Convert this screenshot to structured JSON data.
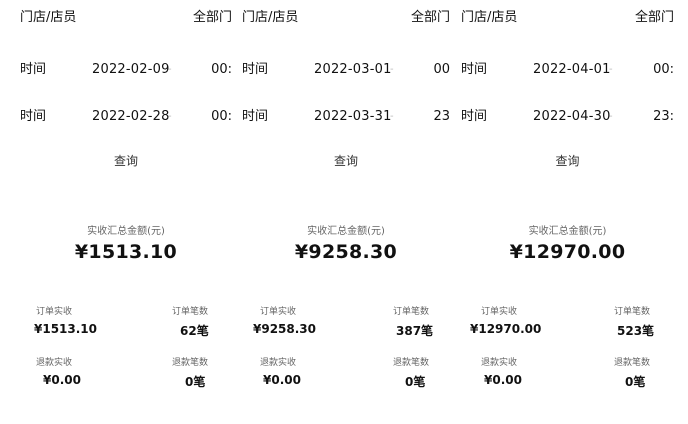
{
  "panels": [
    {
      "store_label": "门店/店员",
      "store_value": "全部门",
      "start_label": "时间",
      "start_date": "2022-02-09",
      "start_time": "00:",
      "end_label": "时间",
      "end_date": "2022-02-28",
      "end_time": "00:",
      "dash": "-",
      "query_label": "查询",
      "total_label": "实收汇总金额(元)",
      "total_value": "¥1513.10",
      "stat1_label": "订单实收",
      "stat1_value": "¥1513.10",
      "stat2_label": "订单笔数",
      "stat2_value": "62笔",
      "stat3_label": "退款实收",
      "stat3_value": "¥0.00",
      "stat4_label": "退款笔数",
      "stat4_value": "0笔"
    },
    {
      "store_label": "门店/店员",
      "store_value": "全部门",
      "start_label": "时间",
      "start_date": "2022-03-01",
      "start_time": "00",
      "end_label": "时间",
      "end_date": "2022-03-31",
      "end_time": "23",
      "dash": "-",
      "query_label": "查询",
      "total_label": "实收汇总金额(元)",
      "total_value": "¥9258.30",
      "stat1_label": "订单实收",
      "stat1_value": "¥9258.30",
      "stat2_label": "订单笔数",
      "stat2_value": "387笔",
      "stat3_label": "退款实收",
      "stat3_value": "¥0.00",
      "stat4_label": "退款笔数",
      "stat4_value": "0笔"
    },
    {
      "store_label": "门店/店员",
      "store_value": "全部门",
      "start_label": "时间",
      "start_date": "2022-04-01",
      "start_time": "00:",
      "end_label": "时间",
      "end_date": "2022-04-30",
      "end_time": "23:",
      "dash": "-",
      "query_label": "查询",
      "total_label": "实收汇总金额(元)",
      "total_value": "¥12970.00",
      "stat1_label": "订单实收",
      "stat1_value": "¥12970.00",
      "stat2_label": "订单笔数",
      "stat2_value": "523笔",
      "stat3_label": "退款实收",
      "stat3_value": "¥0.00",
      "stat4_label": "退款笔数",
      "stat4_value": "0笔"
    }
  ]
}
